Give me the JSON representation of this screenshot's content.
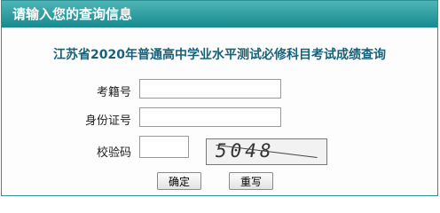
{
  "header": {
    "title": "请输入您的查询信息"
  },
  "form": {
    "subtitle": "江苏省2020年普通高中学业水平测试必修科目考试成绩查询",
    "fields": [
      {
        "label": "考籍号",
        "value": ""
      },
      {
        "label": "身份证号",
        "value": ""
      },
      {
        "label": "校验码",
        "value": ""
      }
    ],
    "captcha_text": "5048"
  },
  "buttons": {
    "submit": "确定",
    "reset": "重写"
  }
}
